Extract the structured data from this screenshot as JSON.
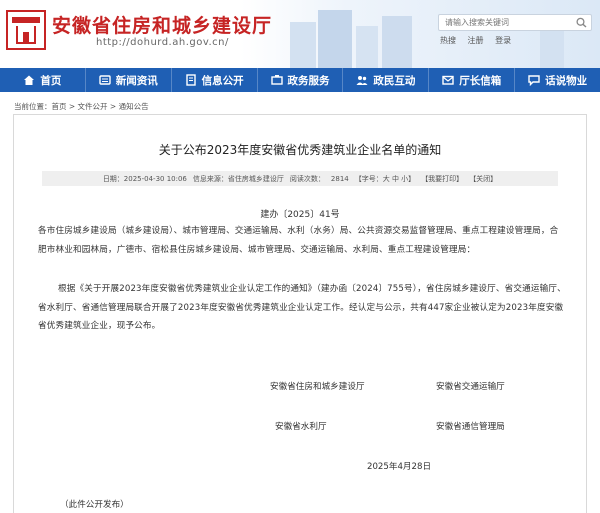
{
  "header": {
    "site_title": "安徽省住房和城乡建设厅",
    "site_url": "http://dohurd.ah.gov.cn/",
    "search_placeholder": "请输入搜索关键词",
    "top_links": [
      "热搜",
      "注册",
      "登录"
    ]
  },
  "nav": {
    "items": [
      {
        "label": "首页",
        "icon": "home-icon"
      },
      {
        "label": "新闻资讯",
        "icon": "news-icon"
      },
      {
        "label": "信息公开",
        "icon": "info-icon"
      },
      {
        "label": "政务服务",
        "icon": "service-icon"
      },
      {
        "label": "政民互动",
        "icon": "interaction-icon"
      },
      {
        "label": "厅长信箱",
        "icon": "mailbox-icon"
      },
      {
        "label": "话说物业",
        "icon": "chat-icon"
      }
    ],
    "bg_color": "#1f5fb4"
  },
  "breadcrumb": "当前位置：首页 > 文件公开 > 通知公告",
  "article": {
    "title": "关于公布2023年度安徽省优秀建筑业企业名单的通知",
    "date": "日期：2025-04-30 10:06",
    "source": "信息来源：省住房城乡建设厅",
    "views_label": "阅读次数：",
    "views": "2814",
    "font_size_controls": "【字号：大 中 小】",
    "print": "【我要打印】",
    "close": "【关闭】",
    "doc_no": "建办〔2025〕41号",
    "para1": "各市住房城乡建设局（城乡建设局）、城市管理局、交通运输局、水利（水务）局、公共资源交易监督管理局、重点工程建设管理局，合肥市林业和园林局，广德市、宿松县住房城乡建设局、城市管理局、交通运输局、水利局、重点工程建设管理局：",
    "para2": "根据《关于开展2023年度安徽省优秀建筑业企业认定工作的通知》（建办函〔2024〕755号），省住房城乡建设厅、省交通运输厅、省水利厅、省通信管理局联合开展了2023年度安徽省优秀建筑业企业认定工作。经认定与公示，共有447家企业被认定为2023年度安徽省优秀建筑业企业，现予公布。",
    "signatures": [
      "安徽省住房和城乡建设厅",
      "安徽省交通运输厅",
      "安徽省水利厅",
      "安徽省通信管理局"
    ],
    "sign_date": "2025年4月28日",
    "footer_note": "（此件公开发布）"
  },
  "colors": {
    "brand_red": "#c62424",
    "nav_blue": "#1f5fb4"
  }
}
